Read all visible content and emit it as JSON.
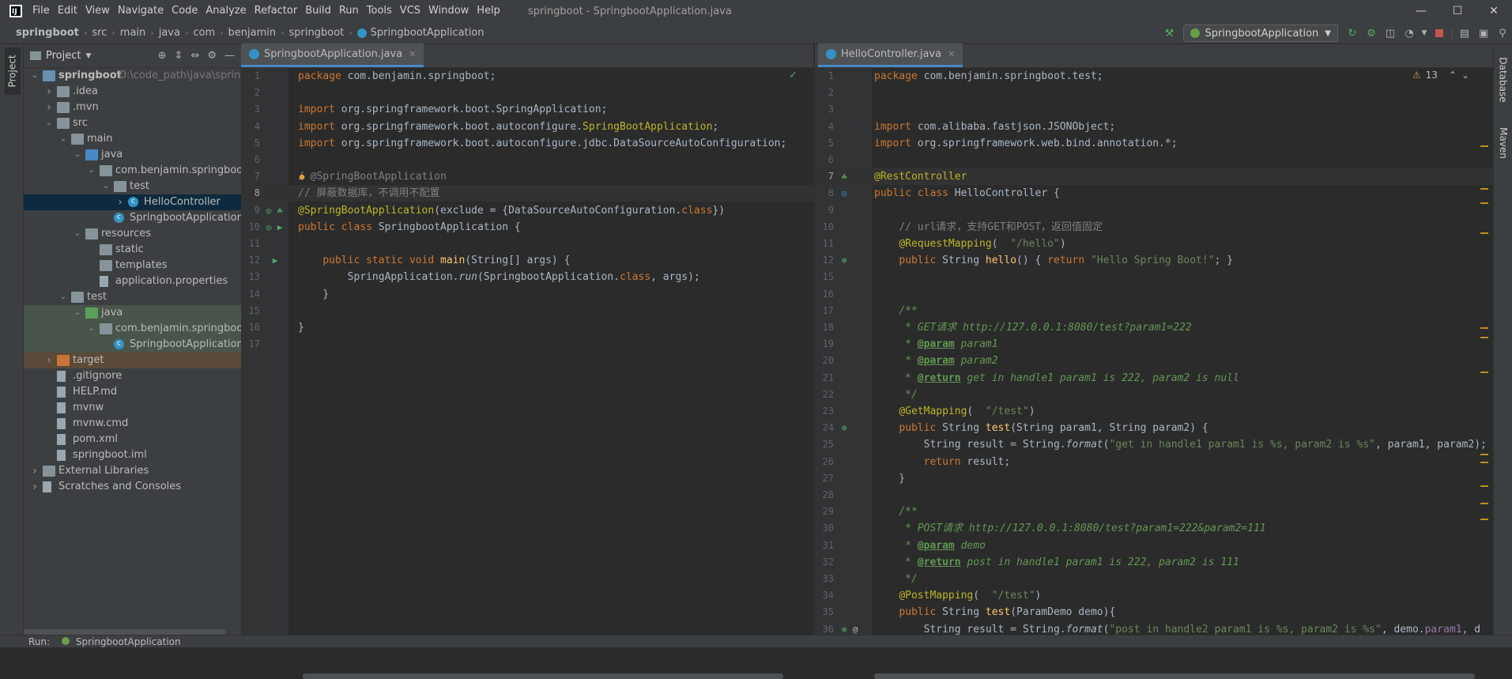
{
  "window": {
    "title": "springboot - SpringbootApplication.java"
  },
  "menu": [
    "File",
    "Edit",
    "View",
    "Navigate",
    "Code",
    "Analyze",
    "Refactor",
    "Build",
    "Run",
    "Tools",
    "VCS",
    "Window",
    "Help"
  ],
  "breadcrumbs": [
    "springboot",
    "src",
    "main",
    "java",
    "com",
    "benjamin",
    "springboot",
    "SpringbootApplication"
  ],
  "run_config": "SpringbootApplication",
  "project_panel": {
    "title": "Project",
    "tab_label": "Project",
    "tree": [
      {
        "label": "springboot",
        "extra": "D:\\code_path\\java\\springbo",
        "depth": 0,
        "arrow": "open",
        "icon": "module"
      },
      {
        "label": ".idea",
        "depth": 1,
        "arrow": "closed",
        "icon": "folder"
      },
      {
        "label": ".mvn",
        "depth": 1,
        "arrow": "closed",
        "icon": "folder"
      },
      {
        "label": "src",
        "depth": 1,
        "arrow": "open",
        "icon": "folder"
      },
      {
        "label": "main",
        "depth": 2,
        "arrow": "open",
        "icon": "folder"
      },
      {
        "label": "java",
        "depth": 3,
        "arrow": "open",
        "icon": "folder-blue"
      },
      {
        "label": "com.benjamin.springboot",
        "depth": 4,
        "arrow": "open",
        "icon": "folder"
      },
      {
        "label": "test",
        "depth": 5,
        "arrow": "open",
        "icon": "folder"
      },
      {
        "label": "HelloController",
        "depth": 6,
        "arrow": "closed",
        "icon": "class",
        "state": "selected"
      },
      {
        "label": "SpringbootApplication",
        "depth": 5,
        "arrow": "none",
        "icon": "class"
      },
      {
        "label": "resources",
        "depth": 3,
        "arrow": "open",
        "icon": "folder"
      },
      {
        "label": "static",
        "depth": 4,
        "arrow": "none",
        "icon": "folder"
      },
      {
        "label": "templates",
        "depth": 4,
        "arrow": "none",
        "icon": "folder"
      },
      {
        "label": "application.properties",
        "depth": 4,
        "arrow": "none",
        "icon": "file"
      },
      {
        "label": "test",
        "depth": 2,
        "arrow": "open",
        "icon": "folder"
      },
      {
        "label": "java",
        "depth": 3,
        "arrow": "open",
        "icon": "folder-green",
        "state": "test"
      },
      {
        "label": "com.benjamin.springboot",
        "depth": 4,
        "arrow": "open",
        "icon": "folder",
        "state": "test"
      },
      {
        "label": "SpringbootApplicationTe",
        "depth": 5,
        "arrow": "none",
        "icon": "class",
        "state": "test"
      },
      {
        "label": "target",
        "depth": 1,
        "arrow": "closed",
        "icon": "folder-orange",
        "state": "excluded"
      },
      {
        "label": ".gitignore",
        "depth": 1,
        "arrow": "none",
        "icon": "file"
      },
      {
        "label": "HELP.md",
        "depth": 1,
        "arrow": "none",
        "icon": "file"
      },
      {
        "label": "mvnw",
        "depth": 1,
        "arrow": "none",
        "icon": "file"
      },
      {
        "label": "mvnw.cmd",
        "depth": 1,
        "arrow": "none",
        "icon": "file"
      },
      {
        "label": "pom.xml",
        "depth": 1,
        "arrow": "none",
        "icon": "file"
      },
      {
        "label": "springboot.iml",
        "depth": 1,
        "arrow": "none",
        "icon": "file"
      },
      {
        "label": "External Libraries",
        "depth": 0,
        "arrow": "closed",
        "icon": "library"
      },
      {
        "label": "Scratches and Consoles",
        "depth": 0,
        "arrow": "closed",
        "icon": "scratch"
      }
    ]
  },
  "editor1": {
    "tab": "SpringbootApplication.java",
    "lines": [
      [
        [
          "kw",
          "package "
        ],
        [
          "t",
          "com.benjamin.springboot;"
        ]
      ],
      [],
      [
        [
          "kw",
          "import "
        ],
        [
          "t",
          "org.springframework.boot.SpringApplication;"
        ]
      ],
      [
        [
          "kw",
          "import "
        ],
        [
          "t",
          "org.springframework.boot.autoconfigure."
        ],
        [
          "ann",
          "SpringBootApplication"
        ],
        [
          "t",
          ";"
        ]
      ],
      [
        [
          "kw",
          "import "
        ],
        [
          "t",
          "org.springframework.boot.autoconfigure.jdbc.DataSourceAutoConfiguration;"
        ]
      ],
      [],
      [
        [
          "cm",
          "/ @SpringBootApplication"
        ]
      ],
      [
        [
          "cm",
          "// 屏蔽数据库，不调用不配置"
        ]
      ],
      [
        [
          "ann",
          "@SpringBootApplication"
        ],
        [
          "t",
          "(exclude = {DataSourceAutoConfiguration."
        ],
        [
          "kw",
          "class"
        ],
        [
          "t",
          "})"
        ]
      ],
      [
        [
          "kw",
          "public class "
        ],
        [
          "t",
          "SpringbootApplication {"
        ]
      ],
      [],
      [
        [
          "t",
          "    "
        ],
        [
          "kw",
          "public static void "
        ],
        [
          "fn",
          "main"
        ],
        [
          "t",
          "(String[] args) {"
        ]
      ],
      [
        [
          "t",
          "        SpringApplication."
        ],
        [
          "italic",
          "run"
        ],
        [
          "t",
          "(SpringbootApplication."
        ],
        [
          "kw",
          "class"
        ],
        [
          "t",
          ", args);"
        ]
      ],
      [
        [
          "t",
          "    }"
        ]
      ],
      [],
      [
        [
          "t",
          "}"
        ]
      ],
      []
    ]
  },
  "editor2": {
    "tab": "HelloController.java",
    "warnings": "13",
    "line_numbers": [
      1,
      2,
      3,
      4,
      5,
      6,
      7,
      8,
      9,
      10,
      11,
      12,
      15,
      16,
      17,
      18,
      19,
      20,
      21,
      22,
      23,
      24,
      25,
      26,
      27,
      28,
      29,
      30,
      31,
      32,
      33,
      34,
      35,
      36
    ],
    "lines": [
      [
        [
          "kw",
          "package "
        ],
        [
          "t",
          "com.benjamin.springboot.test;"
        ]
      ],
      [],
      [],
      [
        [
          "kw",
          "import "
        ],
        [
          "t",
          "com.alibaba.fastjson.JSONObject;"
        ]
      ],
      [
        [
          "kw",
          "import "
        ],
        [
          "t",
          "org.springframework.web.bind.annotation.*;"
        ]
      ],
      [],
      [
        [
          "ann",
          "@RestController"
        ]
      ],
      [
        [
          "kw",
          "public class "
        ],
        [
          "t",
          "HelloController {"
        ]
      ],
      [],
      [
        [
          "t",
          "    "
        ],
        [
          "cm",
          "// url请求，支持GET和POST，返回值固定"
        ]
      ],
      [
        [
          "t",
          "    "
        ],
        [
          "ann",
          "@RequestMapping"
        ],
        [
          "t",
          "(  "
        ],
        [
          "str",
          "\"/hello\""
        ],
        [
          "t",
          ")"
        ]
      ],
      [
        [
          "t",
          "    "
        ],
        [
          "kw",
          "public "
        ],
        [
          "t",
          "String "
        ],
        [
          "fn",
          "hello"
        ],
        [
          "t",
          "() { "
        ],
        [
          "kw",
          "return "
        ],
        [
          "str",
          "\"Hello Spring Boot!\""
        ],
        [
          "t",
          "; }"
        ]
      ],
      [],
      [],
      [
        [
          "t",
          "    "
        ],
        [
          "doc",
          "/**"
        ]
      ],
      [
        [
          "t",
          "    "
        ],
        [
          "doc",
          " * GET请求 http://127.0.0.1:8080/test?param1=222"
        ]
      ],
      [
        [
          "t",
          "    "
        ],
        [
          "doc",
          " * "
        ],
        [
          "doctag",
          "@param"
        ],
        [
          "doc",
          " param1"
        ]
      ],
      [
        [
          "t",
          "    "
        ],
        [
          "doc",
          " * "
        ],
        [
          "doctag",
          "@param"
        ],
        [
          "doc",
          " param2"
        ]
      ],
      [
        [
          "t",
          "    "
        ],
        [
          "doc",
          " * "
        ],
        [
          "doctag",
          "@return"
        ],
        [
          "doc",
          " get in handle1 param1 is 222, param2 is null"
        ]
      ],
      [
        [
          "t",
          "    "
        ],
        [
          "doc",
          " */"
        ]
      ],
      [
        [
          "t",
          "    "
        ],
        [
          "ann",
          "@GetMapping"
        ],
        [
          "t",
          "(  "
        ],
        [
          "str",
          "\"/test\""
        ],
        [
          "t",
          ")"
        ]
      ],
      [
        [
          "t",
          "    "
        ],
        [
          "kw",
          "public "
        ],
        [
          "t",
          "String "
        ],
        [
          "fn",
          "test"
        ],
        [
          "t",
          "(String param1, String param2) {"
        ]
      ],
      [
        [
          "t",
          "        String result = String."
        ],
        [
          "italic",
          "format"
        ],
        [
          "t",
          "("
        ],
        [
          "str",
          "\"get in handle1 param1 is %s, param2 is %s\""
        ],
        [
          "t",
          ", param1, param2);"
        ]
      ],
      [
        [
          "t",
          "        "
        ],
        [
          "kw",
          "return "
        ],
        [
          "t",
          "result;"
        ]
      ],
      [
        [
          "t",
          "    }"
        ]
      ],
      [],
      [
        [
          "t",
          "    "
        ],
        [
          "doc",
          "/**"
        ]
      ],
      [
        [
          "t",
          "    "
        ],
        [
          "doc",
          " * POST请求 http://127.0.0.1:8080/test?param1=222&param2=111"
        ]
      ],
      [
        [
          "t",
          "    "
        ],
        [
          "doc",
          " * "
        ],
        [
          "doctag",
          "@param"
        ],
        [
          "doc",
          " demo"
        ]
      ],
      [
        [
          "t",
          "    "
        ],
        [
          "doc",
          " * "
        ],
        [
          "doctag",
          "@return"
        ],
        [
          "doc",
          " post in handle1 param1 is 222, param2 is 111"
        ]
      ],
      [
        [
          "t",
          "    "
        ],
        [
          "doc",
          " */"
        ]
      ],
      [
        [
          "t",
          "    "
        ],
        [
          "ann",
          "@PostMapping"
        ],
        [
          "t",
          "(  "
        ],
        [
          "str",
          "\"/test\""
        ],
        [
          "t",
          ")"
        ]
      ],
      [
        [
          "t",
          "    "
        ],
        [
          "kw",
          "public "
        ],
        [
          "t",
          "String "
        ],
        [
          "fn",
          "test"
        ],
        [
          "t",
          "(ParamDemo demo){"
        ]
      ],
      [
        [
          "t",
          "        String result = String."
        ],
        [
          "italic",
          "format"
        ],
        [
          "t",
          "("
        ],
        [
          "str",
          "\"post in handle2 param1 is %s, param2 is %s\""
        ],
        [
          "t",
          ", demo."
        ],
        [
          "field",
          "param1"
        ],
        [
          "t",
          ", d"
        ]
      ]
    ]
  },
  "right_tool_windows": [
    "Database",
    "Maven"
  ],
  "bottom": {
    "run_label": "Run:",
    "run_config": "SpringbootApplication"
  },
  "colors": {
    "keyword": "#cc7832",
    "annotation": "#bbb529",
    "string": "#6a8759",
    "comment": "#808080",
    "doc": "#629755",
    "function": "#ffc66d",
    "selection": "#0d293e"
  }
}
